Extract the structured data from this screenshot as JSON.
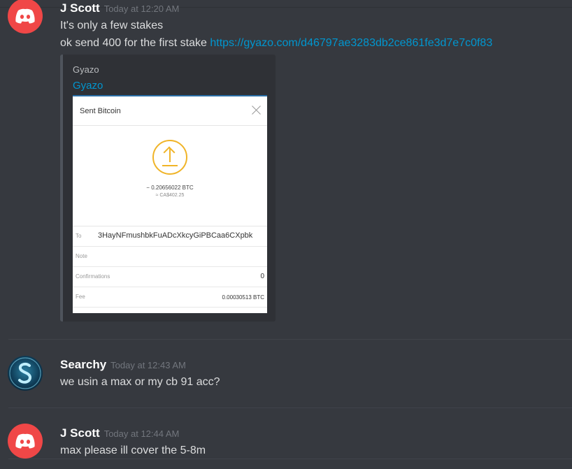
{
  "messages": [
    {
      "author": "J Scott",
      "timestamp": "Today at 12:20 AM",
      "lines": [
        "It's only a few stakes",
        "ok send 400 for the first stake "
      ],
      "link": "https://gyazo.com/d46797ae3283db2ce861fe3d7e7c0f83",
      "embed": {
        "provider": "Gyazo",
        "title": "Gyazo",
        "screenshot": {
          "title": "Sent Bitcoin",
          "amount": "− 0.20656022 BTC",
          "fiat": "≈ CA$402.25",
          "rows": [
            {
              "label": "To",
              "value": "3HayNFmushbkFuADcXkcyGiPBCaa6CXpbk"
            },
            {
              "label": "Note",
              "value": ""
            },
            {
              "label": "Confirmations",
              "value": "0"
            },
            {
              "label": "Fee",
              "value": "0.00030513 BTC"
            }
          ]
        }
      }
    },
    {
      "author": "Searchy",
      "timestamp": "Today at 12:43 AM",
      "lines": [
        "we usin a max or my cb 91 acc?"
      ]
    },
    {
      "author": "J Scott",
      "timestamp": "Today at 12:44 AM",
      "lines": [
        "max please ill cover the 5-8m"
      ]
    }
  ],
  "colors": {
    "background": "#36393f",
    "link": "#0096cf",
    "discord_avatar": "#f04747",
    "sent_icon": "#f0b428"
  },
  "icons": {
    "avatar_jscott": "discord-logo-icon",
    "avatar_searchy": "searchy-logo-icon",
    "close": "close-icon",
    "sent": "upload-arrow-icon"
  }
}
